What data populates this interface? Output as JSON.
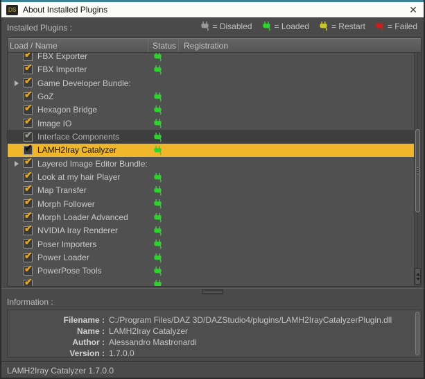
{
  "window": {
    "title": "About Installed Plugins",
    "app_icon_text": "DS",
    "close_glyph": "✕"
  },
  "icons": {
    "check": "✔"
  },
  "colors": {
    "selection": "#efb62b",
    "titlebar_accent": "#3b8294",
    "check": "#e8a61e",
    "status": {
      "disabled": "#9a9a9a",
      "loaded": "#2fd32f",
      "restart": "#c9c92a",
      "failed": "#d41a1a"
    }
  },
  "plugins_section": {
    "label": "Installed Plugins :",
    "legend": [
      {
        "icon": "plug-icon",
        "label": "= Disabled",
        "color": "#9a9a9a"
      },
      {
        "icon": "plug-icon",
        "label": "= Loaded",
        "color": "#2fd32f"
      },
      {
        "icon": "plug-icon",
        "label": "= Restart",
        "color": "#c9c92a"
      },
      {
        "icon": "plug-icon",
        "label": "= Failed",
        "color": "#d41a1a"
      }
    ],
    "columns": [
      "Load / Name",
      "Status",
      "Registration"
    ],
    "rows": [
      {
        "name": "FBX Exporter",
        "checked": true,
        "status": "loaded",
        "expandable": false,
        "row_style": null
      },
      {
        "name": "FBX Importer",
        "checked": true,
        "status": "loaded",
        "expandable": false,
        "row_style": null
      },
      {
        "name": "Game Developer Bundle:",
        "checked": true,
        "status": null,
        "expandable": true,
        "row_style": null
      },
      {
        "name": "GoZ",
        "checked": true,
        "status": "loaded",
        "expandable": false,
        "row_style": null
      },
      {
        "name": "Hexagon Bridge",
        "checked": true,
        "status": "loaded",
        "expandable": false,
        "row_style": null
      },
      {
        "name": "Image IO",
        "checked": true,
        "status": "loaded",
        "expandable": false,
        "row_style": null
      },
      {
        "name": "Interface Components",
        "checked": true,
        "status": "loaded",
        "expandable": false,
        "row_style": "dim"
      },
      {
        "name": "LAMH2Iray Catalyzer",
        "checked": true,
        "status": "loaded",
        "expandable": false,
        "row_style": "selected"
      },
      {
        "name": "Layered Image Editor Bundle:",
        "checked": true,
        "status": null,
        "expandable": true,
        "row_style": null
      },
      {
        "name": "Look at my hair Player",
        "checked": true,
        "status": "loaded",
        "expandable": false,
        "row_style": null
      },
      {
        "name": "Map Transfer",
        "checked": true,
        "status": "loaded",
        "expandable": false,
        "row_style": null
      },
      {
        "name": "Morph Follower",
        "checked": true,
        "status": "loaded",
        "expandable": false,
        "row_style": null
      },
      {
        "name": "Morph Loader Advanced",
        "checked": true,
        "status": "loaded",
        "expandable": false,
        "row_style": null
      },
      {
        "name": "NVIDIA Iray Renderer",
        "checked": true,
        "status": "loaded",
        "expandable": false,
        "row_style": null
      },
      {
        "name": "Poser Importers",
        "checked": true,
        "status": "loaded",
        "expandable": false,
        "row_style": null
      },
      {
        "name": "Power Loader",
        "checked": true,
        "status": "loaded",
        "expandable": false,
        "row_style": null
      },
      {
        "name": "PowerPose Tools",
        "checked": true,
        "status": "loaded",
        "expandable": false,
        "row_style": null
      },
      {
        "name": "",
        "checked": true,
        "status": "loaded",
        "expandable": false,
        "row_style": null
      }
    ]
  },
  "information_section": {
    "label": "Information :",
    "fields": [
      {
        "label": "Filename :",
        "value": "C:/Program Files/DAZ 3D/DAZStudio4/plugins/LAMH2IrayCatalyzerPlugin.dll"
      },
      {
        "label": "Name :",
        "value": "LAMH2Iray Catalyzer"
      },
      {
        "label": "Author :",
        "value": "Alessandro Mastronardi"
      },
      {
        "label": "Version :",
        "value": "1.7.0.0"
      }
    ]
  },
  "status_bar": {
    "text": "LAMH2Iray Catalyzer 1.7.0.0"
  }
}
